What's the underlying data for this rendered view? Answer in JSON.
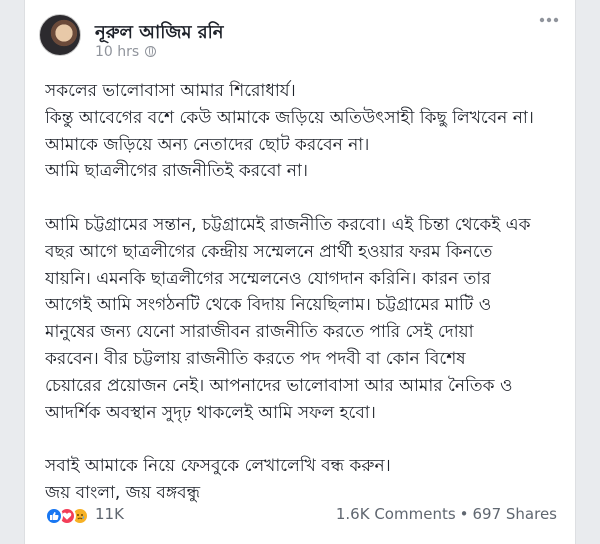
{
  "post": {
    "author": "নূরুল আজিম রনি",
    "time": "10 hrs",
    "lines": [
      "সকলের ভালোবাসা আমার শিরোধার্য।",
      "কিন্তু আবেগের বশে কেউ আমাকে জড়িয়ে অতিউৎসাহী কিছু লিখবেন না।",
      "আমাকে জড়িয়ে অন্য নেতাদের ছোট করবেন না।",
      "আমি ছাত্রলীগের রাজনীতিই করবো না।",
      "",
      "আমি চট্টগ্রামের সন্তান, চট্টগ্রামেই রাজনীতি করবো। এই চিন্তা থেকেই এক",
      "বছর আগে ছাত্রলীগের কেন্দ্রীয় সম্মেলনে প্রার্থী হওয়ার ফরম কিনতে",
      "যায়নি। এমনকি ছাত্রলীগের সম্মেলনেও যোগদান করিনি। কারন তার",
      "আগেই আমি সংগঠনটি থেকে বিদায় নিয়েছিলাম। চট্টগ্রামের মাটি ও",
      "মানুষের জন্য যেনো সারাজীবন রাজনীতি করতে পারি সেই দোয়া",
      "করবেন। বীর চট্টলায় রাজনীতি করতে পদ পদবী বা কোন বিশেষ",
      "চেয়ারের প্রয়োজন নেই। আপনাদের ভালোবাসা আর আমার নৈতিক ও",
      "আদর্শিক অবস্থান সুদৃঢ় থাকলেই আমি সফল হবো।",
      "",
      "সবাই আমাকে নিয়ে ফেসবুকে লেখালেখি বন্ধ করুন।",
      "জয় বাংলা, জয় বঙ্গবন্ধু"
    ]
  },
  "footer": {
    "reaction_icons": [
      "like-icon",
      "love-icon",
      "sad-icon"
    ],
    "reaction_count": "11K",
    "comments": "1.6K Comments",
    "separator": "•",
    "shares": "697 Shares"
  },
  "colors": {
    "text": "#1d2129",
    "meta": "#90949c",
    "like": "#1877f2",
    "love": "#f33e58",
    "sad": "#f7b125"
  }
}
